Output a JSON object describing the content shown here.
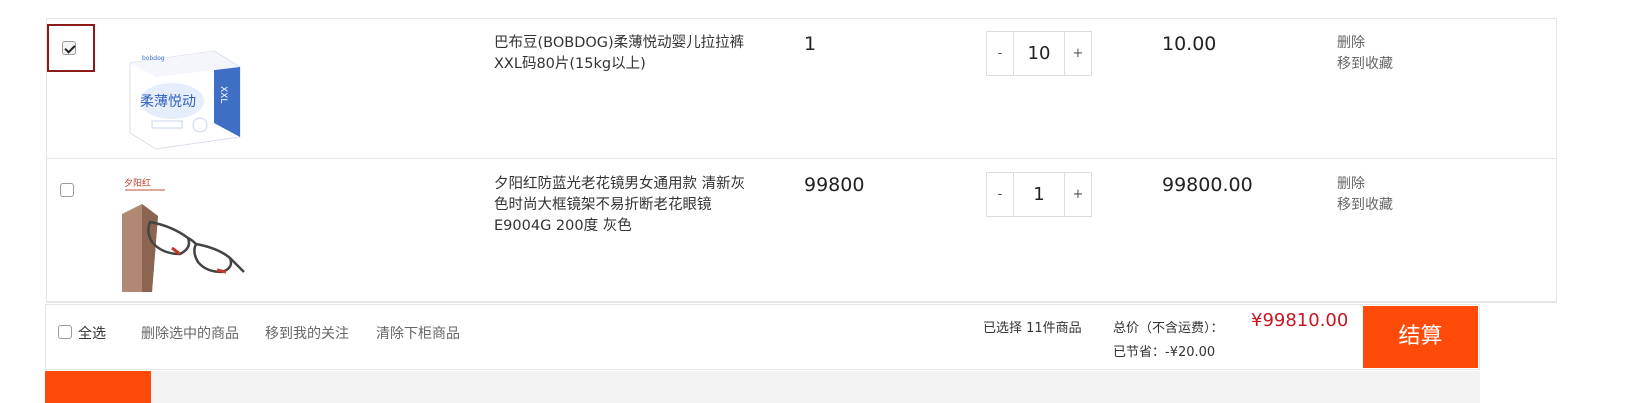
{
  "cart": {
    "items": [
      {
        "checked": true,
        "title": "巴布豆(BOBDOG)柔薄悦动婴儿拉拉裤XXL码80片(15kg以上)",
        "image_icon": "diaper-box-image",
        "price": "1",
        "qty_minus": "-",
        "quantity": "10",
        "qty_plus": "+",
        "subtotal": "10.00",
        "delete_label": "删除",
        "favorite_label": "移到收藏",
        "box_brand": "bobdog",
        "box_name": "柔薄悦动",
        "box_size": "XXL"
      },
      {
        "checked": false,
        "title": "夕阳红防蓝光老花镜男女通用款 清新灰色时尚大框镜架不易折断老花眼镜 E9004G 200度 灰色",
        "image_icon": "glasses-image",
        "image_brand": "夕阳红",
        "price": "99800",
        "qty_minus": "-",
        "quantity": "1",
        "qty_plus": "+",
        "subtotal": "99800.00",
        "delete_label": "删除",
        "favorite_label": "移到收藏"
      }
    ]
  },
  "footer": {
    "select_all_label": "全选",
    "delete_selected": "删除选中的商品",
    "move_to_follow": "移到我的关注",
    "clear_removed": "清除下柜商品",
    "selected_count": "已选择 11件商品",
    "total_label": "总价（不含运费）：",
    "total_value": "¥99810.00",
    "saved_label": "已节省：-¥20.00",
    "checkout_label": "结算"
  },
  "colors": {
    "accent": "#ff4b0a",
    "price_red": "#c81623",
    "focus_border": "#8b1a1a"
  }
}
